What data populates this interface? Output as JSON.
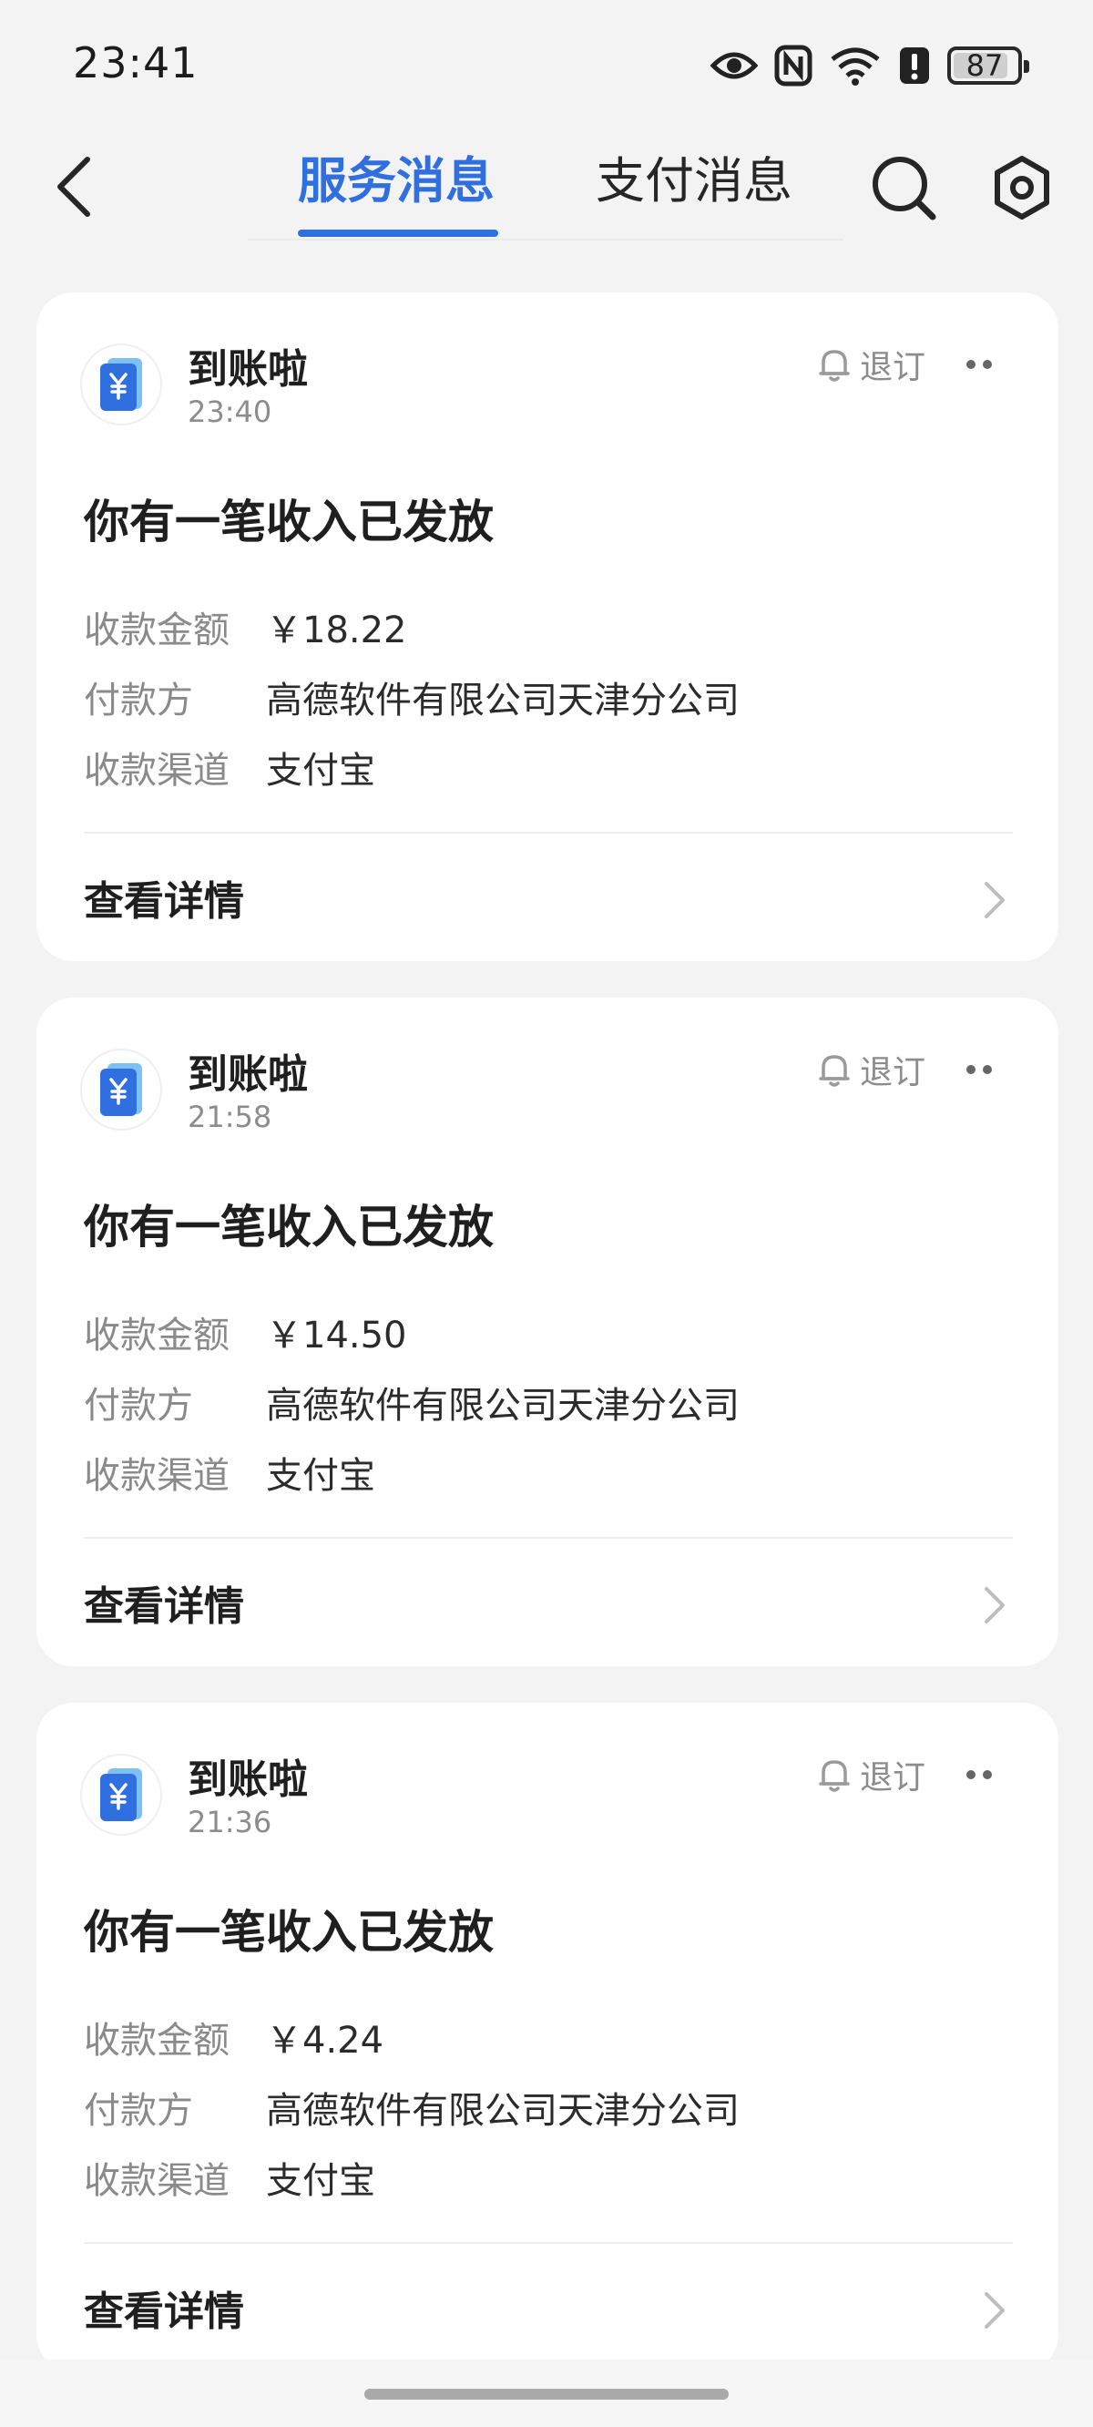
{
  "status_bar": {
    "time": "23:41",
    "icons": [
      "eye-icon",
      "nfc-icon",
      "wifi-icon",
      "alert-icon",
      "battery-icon"
    ],
    "battery_level": "87"
  },
  "header": {
    "tabs": [
      {
        "label": "服务消息",
        "active": true
      },
      {
        "label": "支付消息",
        "active": false
      }
    ],
    "accent_color": "#2f6fe0"
  },
  "messages": [
    {
      "sender": "到账啦",
      "time": "23:40",
      "unsubscribe": "退订",
      "title": "你有一笔收入已发放",
      "rows": [
        {
          "label": "收款金额",
          "value": "￥18.22"
        },
        {
          "label": "付款方",
          "value": "高德软件有限公司天津分公司"
        },
        {
          "label": "收款渠道",
          "value": "支付宝"
        }
      ],
      "detail_label": "查看详情"
    },
    {
      "sender": "到账啦",
      "time": "21:58",
      "unsubscribe": "退订",
      "title": "你有一笔收入已发放",
      "rows": [
        {
          "label": "收款金额",
          "value": "￥14.50"
        },
        {
          "label": "付款方",
          "value": "高德软件有限公司天津分公司"
        },
        {
          "label": "收款渠道",
          "value": "支付宝"
        }
      ],
      "detail_label": "查看详情"
    },
    {
      "sender": "到账啦",
      "time": "21:36",
      "unsubscribe": "退订",
      "title": "你有一笔收入已发放",
      "rows": [
        {
          "label": "收款金额",
          "value": "￥4.24"
        },
        {
          "label": "付款方",
          "value": "高德软件有限公司天津分公司"
        },
        {
          "label": "收款渠道",
          "value": "支付宝"
        }
      ],
      "detail_label": "查看详情"
    }
  ]
}
